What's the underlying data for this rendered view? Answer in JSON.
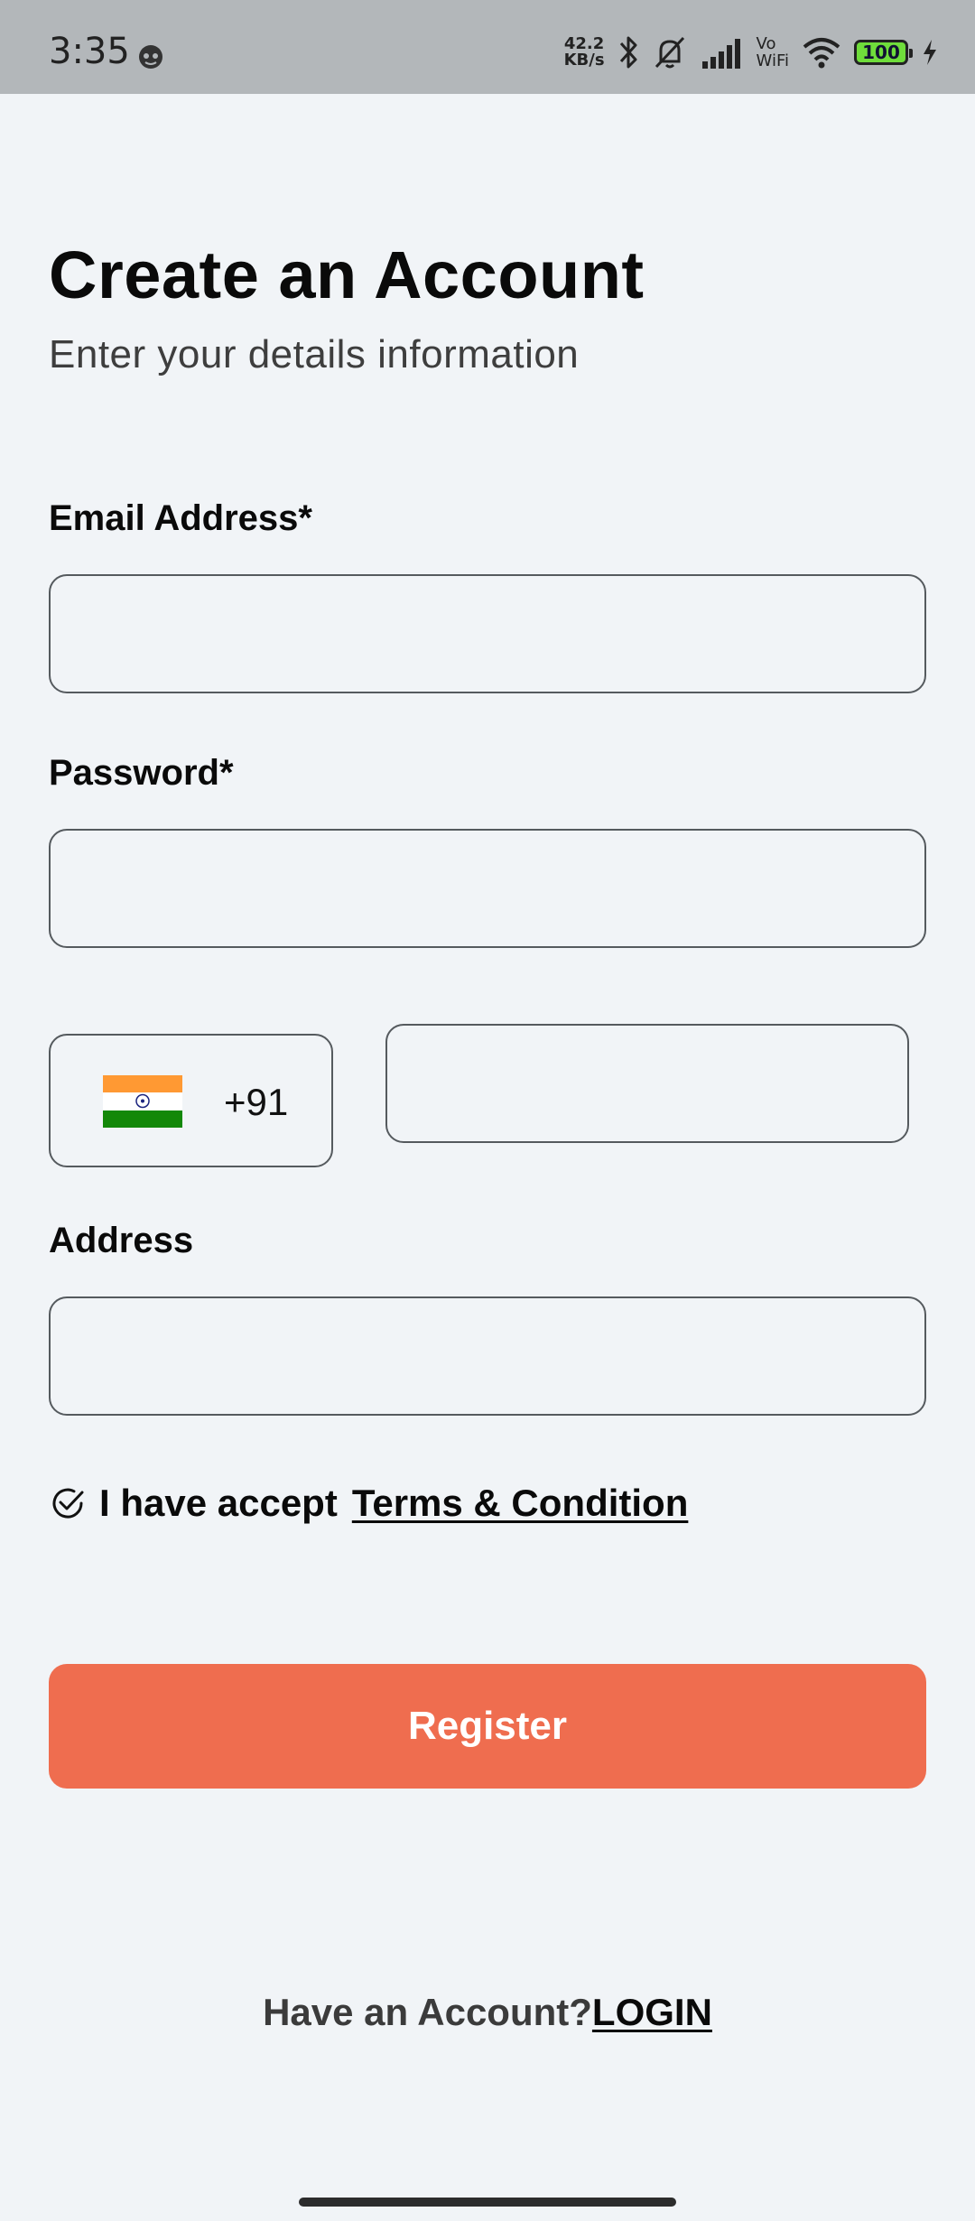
{
  "status_bar": {
    "time": "3:35",
    "net_speed_value": "42.2",
    "net_speed_unit": "KB/s",
    "vowifi_top": "Vo",
    "vowifi_bottom": "WiFi",
    "battery_level": "100",
    "icons": [
      "app-notification-icon",
      "bluetooth-icon",
      "silent-icon",
      "signal-icon",
      "wifi-icon",
      "battery-icon",
      "charging-icon"
    ]
  },
  "header": {
    "title": "Create an Account",
    "subtitle": "Enter your details information"
  },
  "form": {
    "email_label": "Email Address*",
    "email_value": "",
    "password_label": "Password*",
    "password_value": "",
    "country_code": "+91",
    "country_flag": "india-flag-icon",
    "phone_value": "",
    "address_label": "Address",
    "address_value": ""
  },
  "terms": {
    "text": "I have accept",
    "link": "Terms & Condition",
    "checked": true
  },
  "actions": {
    "register_label": "Register",
    "register_color": "#ef6d4f"
  },
  "footer": {
    "prompt": "Have an Account?",
    "login_link": "LOGIN"
  }
}
